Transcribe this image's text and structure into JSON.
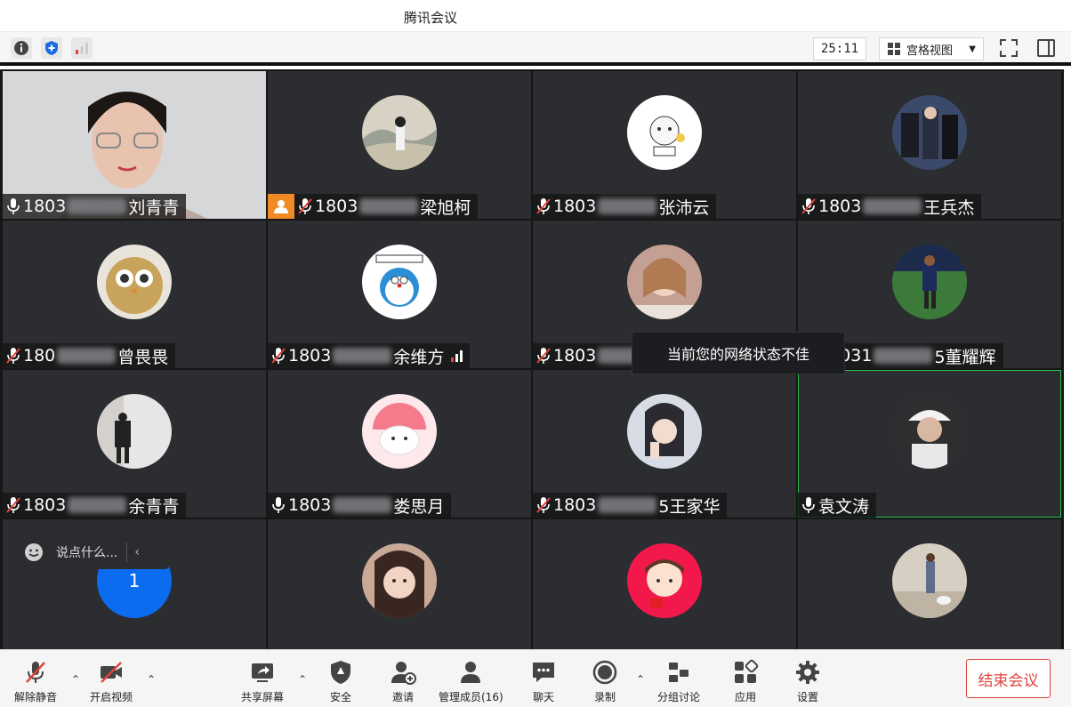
{
  "app": {
    "title": "腾讯会议"
  },
  "topbar": {
    "timer": "25:11",
    "view_label": "宫格视图"
  },
  "tiles": [
    {
      "prefix": "1803",
      "name": "刘青青",
      "mic": "on",
      "host": false,
      "avatar": "video"
    },
    {
      "prefix": "1803",
      "name": "梁旭柯",
      "mic": "off",
      "host": true,
      "avatar": "photo-landscape"
    },
    {
      "prefix": "1803",
      "name": "张沛云",
      "mic": "off",
      "host": false,
      "avatar": "cartoon-thats-ok"
    },
    {
      "prefix": "1803",
      "name": "王兵杰",
      "mic": "off",
      "host": false,
      "avatar": "photo-group"
    },
    {
      "prefix": "180",
      "name": "曾畏畏",
      "mic": "off",
      "host": false,
      "avatar": "owl"
    },
    {
      "prefix": "1803",
      "name": "余维方",
      "mic": "off",
      "host": false,
      "avatar": "doraemon",
      "signal": true
    },
    {
      "prefix": "1803",
      "name": "",
      "mic": "off",
      "host": false,
      "avatar": "portrait-girl"
    },
    {
      "prefix": "18031",
      "name": "5董耀辉",
      "mic": "off",
      "host": false,
      "avatar": "football"
    },
    {
      "prefix": "1803",
      "name": "余青青",
      "mic": "off",
      "host": false,
      "avatar": "person-wall"
    },
    {
      "prefix": "1803",
      "name": "娄思月",
      "mic": "on",
      "host": false,
      "avatar": "watermelon-bunny"
    },
    {
      "prefix": "1803",
      "name": "5王家华",
      "mic": "off",
      "host": false,
      "avatar": "girl-hand"
    },
    {
      "prefix": "",
      "name": "袁文涛",
      "mic": "on",
      "host": false,
      "avatar": "hat-guy",
      "active": true
    },
    {
      "prefix": "",
      "name": "",
      "mic": "none",
      "host": false,
      "avatar": "blue-1",
      "avatar_text": "1"
    },
    {
      "prefix": "",
      "name": "",
      "mic": "none",
      "host": false,
      "avatar": "girl-cry"
    },
    {
      "prefix": "",
      "name": "",
      "mic": "none",
      "host": false,
      "avatar": "cartoon-boy"
    },
    {
      "prefix": "",
      "name": "",
      "mic": "none",
      "host": false,
      "avatar": "dog-walk"
    }
  ],
  "toast": "当前您的网络状态不佳",
  "chat": {
    "placeholder": "说点什么..."
  },
  "toolbar": {
    "unmute": "解除静音",
    "start_video": "开启视频",
    "share_screen": "共享屏幕",
    "security": "安全",
    "invite": "邀请",
    "manage": "管理成员(16)",
    "chat": "聊天",
    "record": "录制",
    "breakout": "分组讨论",
    "apps": "应用",
    "settings": "设置",
    "end": "结束会议"
  },
  "colors": {
    "accent_red": "#e0443e",
    "tile_bg": "#2b2d30",
    "active_border": "#2fbf4f",
    "host_badge": "#f08a24"
  }
}
